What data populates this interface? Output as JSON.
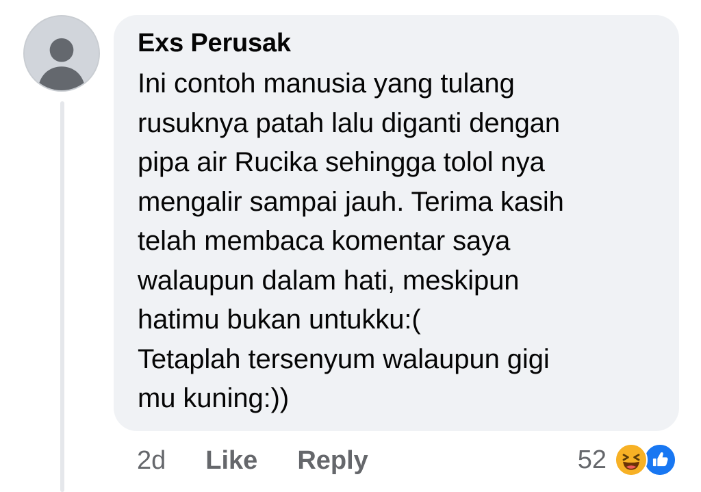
{
  "comment": {
    "author": "Exs Perusak",
    "text": "Ini contoh manusia yang tulang\nrusuknya patah lalu diganti dengan\npipa air Rucika sehingga tolol nya\nmengalir sampai jauh. Terima kasih\ntelah membaca komentar saya\nwalaupun dalam hati, meskipun\nhatimu bukan untukku:(\nTetaplah tersenyum walaupun gigi\nmu kuning:))",
    "timestamp": "2d",
    "actions": {
      "like": "Like",
      "reply": "Reply"
    },
    "reactions": {
      "count": "52",
      "types": [
        "laugh-reaction-icon",
        "like-reaction-icon"
      ]
    }
  },
  "colors": {
    "bubble": "#f0f2f5",
    "primary_text": "#050505",
    "secondary_text": "#65676b",
    "like_blue": "#1877f2",
    "laugh_yellow": "#f7b125"
  }
}
